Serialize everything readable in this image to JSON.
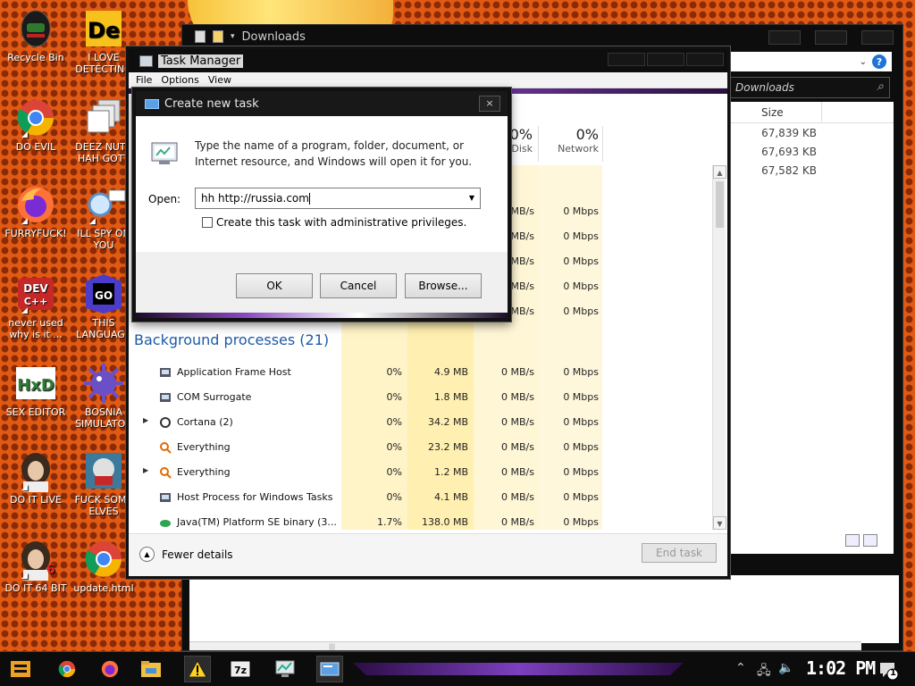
{
  "desktop": {
    "icons": [
      {
        "label": "Recycle Bin"
      },
      {
        "label": "I LOVE\nDETECTING"
      },
      {
        "label": "DO EVIL"
      },
      {
        "label": "DEEZ NUTS\nHAH GOTT"
      },
      {
        "label": "FURRYFUCK!"
      },
      {
        "label": "ILL SPY ON\nYOU"
      },
      {
        "label": "never used\nwhy is it ..."
      },
      {
        "label": "THIS\nLANGUAGE"
      },
      {
        "label": "SEX EDITOR"
      },
      {
        "label": "BOSNIA\nSIMULATOR"
      },
      {
        "label": "DO IT LIVE"
      },
      {
        "label": "FUCK SOME\nELVES"
      },
      {
        "label": "DO IT 64 BIT"
      },
      {
        "label": "update.html"
      }
    ],
    "icon_texts": {
      "de": "De",
      "dev": "DEV\nC++",
      "go": "GO",
      "hxd": "HxD",
      "six": "6"
    }
  },
  "explorer": {
    "title": "Downloads",
    "search_placeholder": "Search Downloads",
    "search_shown": "Downloads",
    "help": "?",
    "size_header": "Size",
    "sizes": [
      "67,839 KB",
      "67,693 KB",
      "67,582 KB"
    ]
  },
  "taskmgr": {
    "title": "Task Manager",
    "menu": [
      "File",
      "Options",
      "View"
    ],
    "headers": {
      "disk_pct": "0%",
      "disk_label": "Disk",
      "net_pct": "0%",
      "net_label": "Network"
    },
    "upper_rows": [
      {
        "disk": "MB/s",
        "net": "0 Mbps"
      },
      {
        "disk": "MB/s",
        "net": "0 Mbps"
      },
      {
        "disk": "MB/s",
        "net": "0 Mbps"
      },
      {
        "disk": "MB/s",
        "net": "0 Mbps"
      },
      {
        "disk": "MB/s",
        "net": "0 Mbps"
      }
    ],
    "group_label": "Background processes (21)",
    "processes": [
      {
        "name": "Application Frame Host",
        "cpu": "0%",
        "mem": "4.9 MB",
        "disk": "0 MB/s",
        "net": "0 Mbps",
        "expand": ""
      },
      {
        "name": "COM Surrogate",
        "cpu": "0%",
        "mem": "1.8 MB",
        "disk": "0 MB/s",
        "net": "0 Mbps",
        "expand": ""
      },
      {
        "name": "Cortana (2)",
        "cpu": "0%",
        "mem": "34.2 MB",
        "disk": "0 MB/s",
        "net": "0 Mbps",
        "expand": "▶"
      },
      {
        "name": "Everything",
        "cpu": "0%",
        "mem": "23.2 MB",
        "disk": "0 MB/s",
        "net": "0 Mbps",
        "expand": ""
      },
      {
        "name": "Everything",
        "cpu": "0%",
        "mem": "1.2 MB",
        "disk": "0 MB/s",
        "net": "0 Mbps",
        "expand": "▶"
      },
      {
        "name": "Host Process for Windows Tasks",
        "cpu": "0%",
        "mem": "4.1 MB",
        "disk": "0 MB/s",
        "net": "0 Mbps",
        "expand": ""
      },
      {
        "name": "Java(TM) Platform SE binary (3...",
        "cpu": "1.7%",
        "mem": "138.0 MB",
        "disk": "0 MB/s",
        "net": "0 Mbps",
        "expand": ""
      }
    ],
    "fewer_details": "Fewer details",
    "end_task": "End task"
  },
  "dialog": {
    "title": "Create new task",
    "close": "×",
    "message": "Type the name of a program, folder, document, or Internet resource, and Windows will open it for you.",
    "open_label": "Open:",
    "open_value": "hh http://russia.com",
    "admin_label": "Create this task with administrative privileges.",
    "ok": "OK",
    "cancel": "Cancel",
    "browse": "Browse..."
  },
  "taskbar": {
    "clock": "1:02 PM",
    "notification_count": "1"
  }
}
